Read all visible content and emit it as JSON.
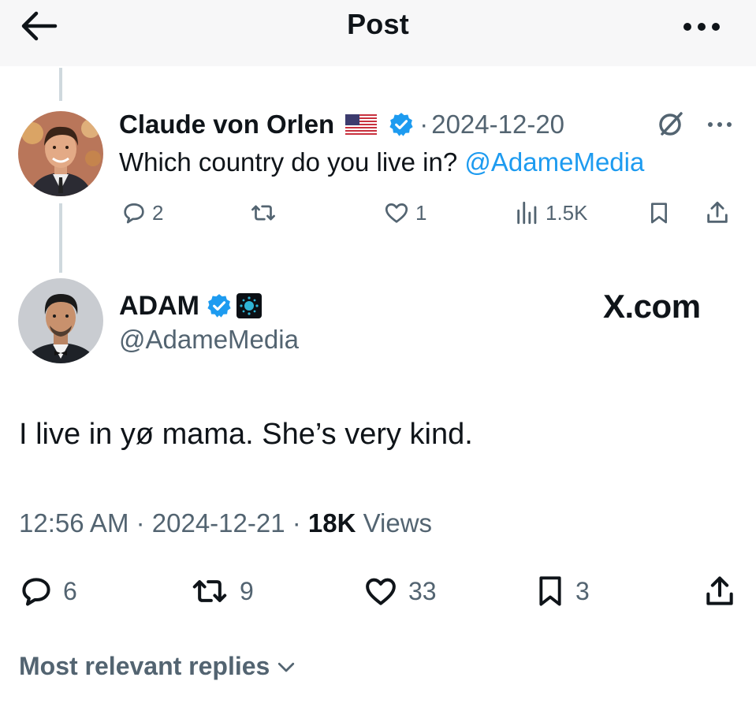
{
  "header": {
    "title": "Post",
    "back_icon": "arrow-left-icon",
    "more_icon": "more-horizontal-icon"
  },
  "parent_post": {
    "author_name": "Claude von Orlen",
    "flag_icon": "us-flag-icon",
    "verified_icon": "verified-badge-icon",
    "separator": "·",
    "date": "2024-12-20",
    "text_before": "Which country do you live in? ",
    "mention": "@AdameMedia",
    "grok_icon": "grok-icon",
    "actions": {
      "replies": "2",
      "reposts": "",
      "likes": "1",
      "views": "1.5K"
    }
  },
  "main_post": {
    "author_name": "ADAM",
    "handle": "@AdameMedia",
    "watermark": "X.com",
    "text": "I live in yø mama. She’s very kind.",
    "time": "12:56 AM",
    "sep1": " · ",
    "date": "2024-12-21",
    "sep2": " · ",
    "views_count": "18K",
    "views_label": " Views",
    "actions": {
      "replies": "6",
      "reposts": "9",
      "likes": "33",
      "bookmarks": "3"
    }
  },
  "replies_sort": {
    "label": "Most relevant replies",
    "chevron_icon": "chevron-down-icon"
  },
  "colors": {
    "accent": "#1d9bf0",
    "secondary_text": "#536471",
    "primary_text": "#0f1419",
    "thread_line": "#cfd9de",
    "header_bg": "#f7f7f8"
  }
}
